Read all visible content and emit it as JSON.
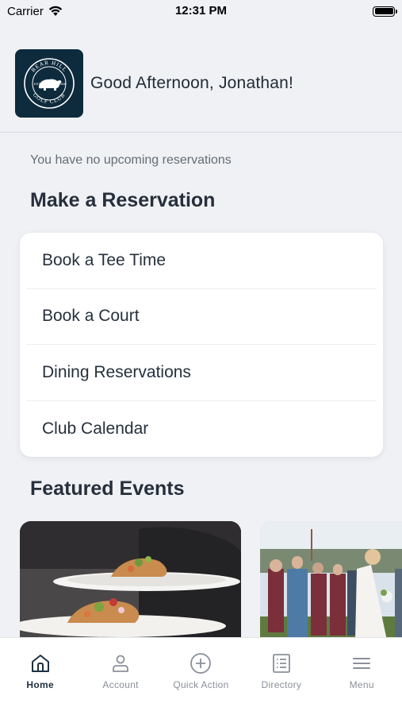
{
  "status_bar": {
    "carrier": "Carrier",
    "time": "12:31 PM"
  },
  "header": {
    "logo_text_top": "BEAR HILL",
    "logo_text_bottom": "GOLF CLUB",
    "logo_est": "EST.",
    "logo_year": "1906",
    "greeting": "Good Afternoon, Jonathan!"
  },
  "reservations": {
    "empty_message": "You have no upcoming reservations",
    "section_title": "Make a Reservation",
    "items": [
      {
        "label": "Book a Tee Time"
      },
      {
        "label": "Book a Court"
      },
      {
        "label": "Dining Reservations"
      },
      {
        "label": "Club Calendar"
      }
    ]
  },
  "featured": {
    "section_title": "Featured Events"
  },
  "tab_bar": {
    "tabs": [
      {
        "label": "Home",
        "icon": "home-icon",
        "active": true
      },
      {
        "label": "Account",
        "icon": "account-icon",
        "active": false
      },
      {
        "label": "Quick Action",
        "icon": "plus-circle-icon",
        "active": false
      },
      {
        "label": "Directory",
        "icon": "directory-icon",
        "active": false
      },
      {
        "label": "Menu",
        "icon": "hamburger-icon",
        "active": false
      }
    ]
  },
  "colors": {
    "logo_bg": "#0e2a3d",
    "page_bg": "#eff1f5",
    "active_tab": "#1f3042"
  }
}
